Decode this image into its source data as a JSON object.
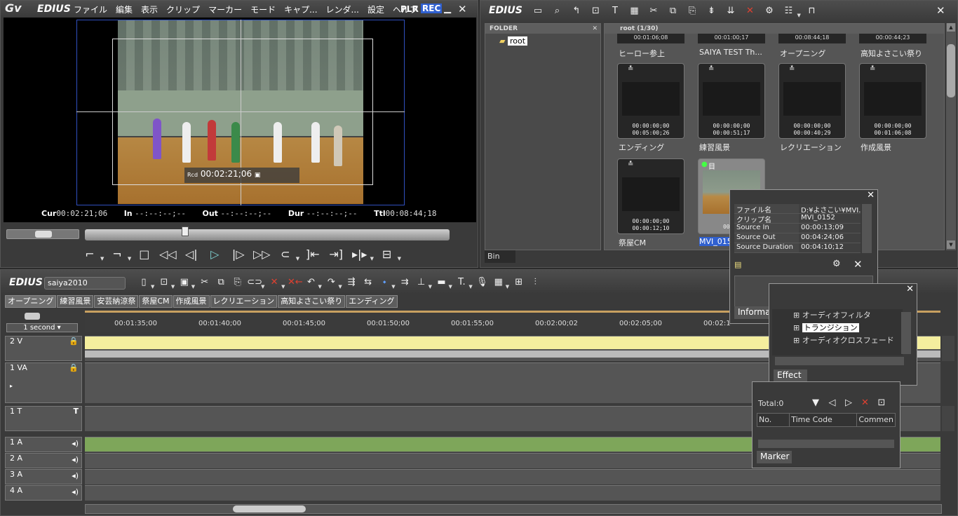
{
  "player": {
    "brand": "EDIUS",
    "menu": [
      "ファイル",
      "編集",
      "表示",
      "クリップ",
      "マーカー",
      "モード",
      "キャプ...",
      "レンダ...",
      "設定",
      "ヘルプ"
    ],
    "plr": "PLR",
    "rec": "REC",
    "overlay": {
      "label": "Rcd",
      "timecode": "00:02:21;06"
    },
    "timecodes": {
      "cur_label": "Cur",
      "cur": "00:02:21;06",
      "in_label": "In",
      "in": "--:--:--;--",
      "out_label": "Out",
      "out": "--:--:--;--",
      "dur_label": "Dur",
      "dur": "--:--:--;--",
      "ttl_label": "Ttl",
      "ttl": "00:08:44;18"
    }
  },
  "bin": {
    "brand": "EDIUS",
    "folder_header": "FOLDER",
    "root": "root",
    "clips_header": "root (1/30)",
    "tab": "Bin",
    "top_row": [
      {
        "tc": "00:01:06;08",
        "name": "ヒーロー参上"
      },
      {
        "tc": "00:01:00;17",
        "name": "SAIYA TEST Th..."
      },
      {
        "tc": "00:08:44;18",
        "name": "オープニング"
      },
      {
        "tc": "00:00:44;23",
        "name": "高知よさこい祭り"
      }
    ],
    "mid_row": [
      {
        "tc1": "00:00:00;00",
        "tc2": "00:05:00;26",
        "name": "エンディング"
      },
      {
        "tc1": "00:00:00;00",
        "tc2": "00:00:51;17",
        "name": "練習風景"
      },
      {
        "tc1": "00:00:00;00",
        "tc2": "00:00:40;29",
        "name": "レクリエーション"
      },
      {
        "tc1": "00:00:00;00",
        "tc2": "00:01:06;08",
        "name": "作成風景"
      }
    ],
    "bottom_row": [
      {
        "tc1": "00:00:00;00",
        "tc2": "00:00:12;10",
        "name": "祭屋CM"
      },
      {
        "tc1": "00:04",
        "name": "MVI_015"
      }
    ]
  },
  "info": {
    "rows": [
      {
        "k": "ファイル名",
        "v": "D:¥よさこい¥MVI..."
      },
      {
        "k": "クリップ名",
        "v": "MVI_0152"
      },
      {
        "k": "Source In",
        "v": "00:00:13;09"
      },
      {
        "k": "Source Out",
        "v": "00:04:24;06"
      },
      {
        "k": "Source Duration",
        "v": "00:04:10;12"
      }
    ],
    "tab": "Information"
  },
  "effect": {
    "items": [
      "オーディオフィルタ",
      "トランジション",
      "オーディオクロスフェード"
    ],
    "tab": "Effect"
  },
  "marker": {
    "total": "Total:0",
    "cols": [
      "No.",
      "Time Code",
      "Commen"
    ],
    "tab": "Marker"
  },
  "timeline": {
    "brand": "EDIUS",
    "project": "saiya2010",
    "seq_tabs": [
      "オープニング",
      "練習風景",
      "安芸納涼祭",
      "祭屋CM",
      "作成風景",
      "レクリエーション",
      "高知よさこい祭り",
      "エンディング"
    ],
    "scale": "1 second",
    "ruler": [
      "00:01:35;00",
      "00:01:40;00",
      "00:01:45;00",
      "00:01:50;00",
      "00:01:55;00",
      "00:02:00;02",
      "00:02:05;00",
      "00:02:1"
    ],
    "tracks": [
      "2 V",
      "1 VA",
      "1 T",
      "1 A",
      "2 A",
      "3 A",
      "4 A"
    ]
  }
}
